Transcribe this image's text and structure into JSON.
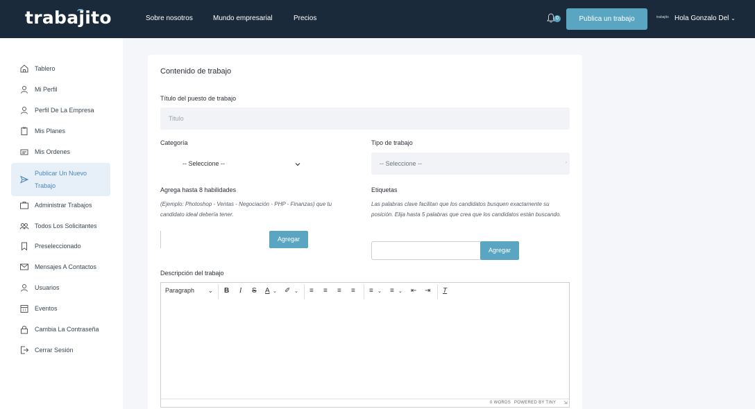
{
  "header": {
    "logo": "trabajito",
    "nav": [
      "Sobre nosotros",
      "Mundo empresarial",
      "Precios"
    ],
    "notification_count": "0",
    "publish_button": "Publica un trabajo",
    "avatar_text": "trabajito",
    "user_greeting": "Hola Gonzalo Del"
  },
  "sidebar": {
    "items": [
      {
        "label": "Tablero",
        "icon": "home-icon"
      },
      {
        "label": "Mi Perfil",
        "icon": "user-icon"
      },
      {
        "label": "Perfil De La Empresa",
        "icon": "user-icon"
      },
      {
        "label": "Mis Planes",
        "icon": "clipboard-icon"
      },
      {
        "label": "Mis Ordenes",
        "icon": "orders-icon"
      },
      {
        "label": "Publicar Un Nuevo Trabajo",
        "icon": "send-icon"
      },
      {
        "label": "Administrar Trabajos",
        "icon": "briefcase-icon"
      },
      {
        "label": "Todos Los Solicitantes",
        "icon": "users-icon"
      },
      {
        "label": "Preseleccionado",
        "icon": "bookmark-icon"
      },
      {
        "label": "Mensajes A Contactos",
        "icon": "mail-icon"
      },
      {
        "label": "Usuarios",
        "icon": "user-icon"
      },
      {
        "label": "Eventos",
        "icon": "calendar-icon"
      },
      {
        "label": "Cambia La Contraseña",
        "icon": "lock-icon"
      },
      {
        "label": "Cerrar Sesión",
        "icon": "logout-icon"
      }
    ]
  },
  "form": {
    "section_title": "Contenido de trabajo",
    "job_title_label": "Título del puesto de trabajo",
    "job_title_placeholder": "Titulo",
    "category_label": "Categoría",
    "category_value": "-- Seleccione --",
    "job_type_label": "Tipo de trabajo",
    "job_type_value": "-- Seleccione --",
    "skills_label": "Agrega hasta 8 habilidades",
    "skills_hint": "(Ejemplo: Photoshop - Ventas - Negociación - PHP - Finanzas) que tu candidato ideal debería tener.",
    "skills_button": "Agregar",
    "tags_label": "Etiquetas",
    "tags_hint": "Las palabras clave facilitan que los candidatos busquen exactamente su posición. Elija hasta 5 palabras que crea que los candidatos están buscando.",
    "tags_button": "Agregar",
    "description_label": "Descripción del trabajo",
    "editor": {
      "block_format": "Paragraph",
      "status": "0 WORDS",
      "powered": "POWERED BY TINY"
    }
  }
}
